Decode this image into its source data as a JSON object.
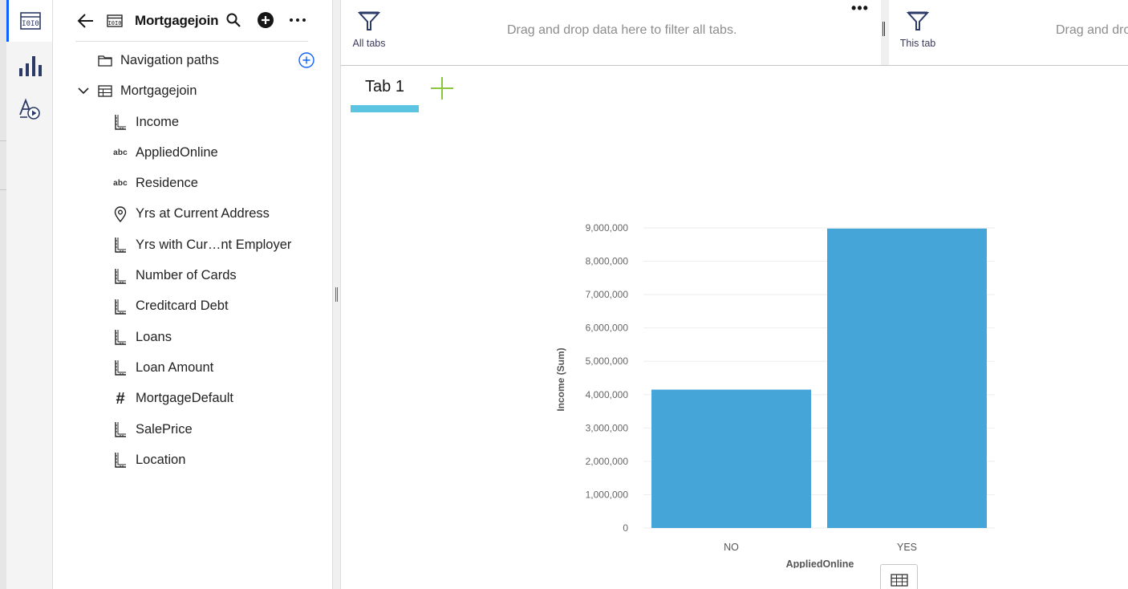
{
  "source": {
    "title": "Mortgagejoin"
  },
  "tree": {
    "navigation_paths": "Navigation paths",
    "table_name": "Mortgagejoin",
    "fields": [
      {
        "label": "Income",
        "icon": "measure-ruler-icon"
      },
      {
        "label": "AppliedOnline",
        "icon": "abc-text-icon",
        "icon_text": "abc"
      },
      {
        "label": "Residence",
        "icon": "abc-text-icon",
        "icon_text": "abc"
      },
      {
        "label": "Yrs at Current Address",
        "icon": "location-pin-icon"
      },
      {
        "label": "Yrs with Cur…nt Employer",
        "icon": "measure-ruler-icon"
      },
      {
        "label": "Number of Cards",
        "icon": "measure-ruler-icon"
      },
      {
        "label": "Creditcard Debt",
        "icon": "measure-ruler-icon"
      },
      {
        "label": "Loans",
        "icon": "measure-ruler-icon"
      },
      {
        "label": "Loan Amount",
        "icon": "measure-ruler-icon"
      },
      {
        "label": "MortgageDefault",
        "icon": "hash-icon",
        "icon_text": "#"
      },
      {
        "label": "SalePrice",
        "icon": "measure-ruler-icon"
      },
      {
        "label": "Location",
        "icon": "measure-ruler-icon"
      }
    ]
  },
  "filters": {
    "all_tabs_label": "All tabs",
    "all_tabs_drop": "Drag and drop data here to filter all tabs.",
    "this_tab_label": "This tab",
    "this_tab_drop": "Drag and dro"
  },
  "tabs": [
    {
      "label": "Tab 1"
    }
  ],
  "colors": {
    "bar": "#45a4d8",
    "tab_underline": "#5bc4e0",
    "add_tab": "#8cc63f",
    "active_rail": "#0f62fe"
  },
  "chart_data": {
    "type": "bar",
    "categories": [
      "NO",
      "YES"
    ],
    "values": [
      4150000,
      8980000
    ],
    "xlabel": "AppliedOnline",
    "ylabel": "Income (Sum)",
    "ylim": [
      0,
      9000000
    ],
    "yticks": [
      "0",
      "1,000,000",
      "2,000,000",
      "3,000,000",
      "4,000,000",
      "5,000,000",
      "6,000,000",
      "7,000,000",
      "8,000,000",
      "9,000,000"
    ],
    "grid": true,
    "legend": "none"
  }
}
